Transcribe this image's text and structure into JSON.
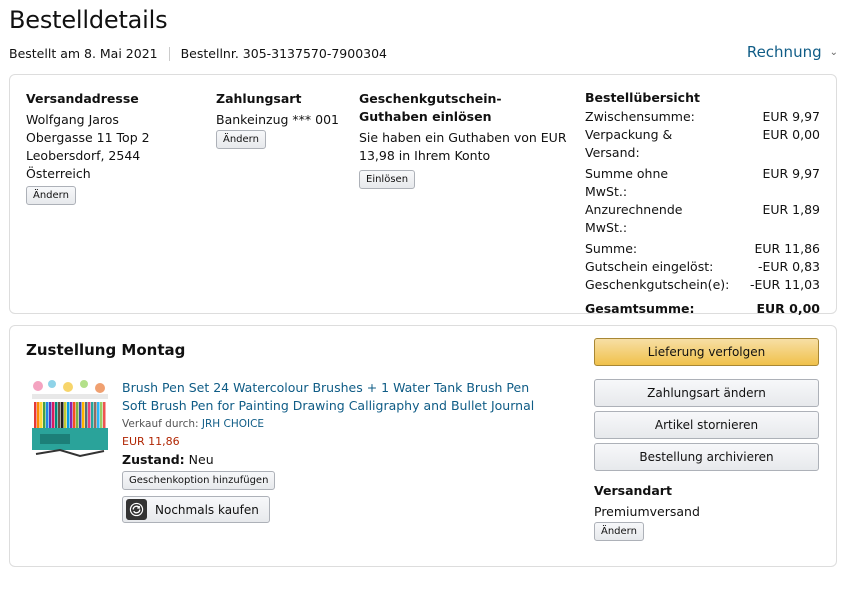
{
  "header": {
    "title": "Bestelldetails",
    "ordered_on": "Bestellt am 8. Mai 2021",
    "order_number": "Bestellnr. 305-3137570-7900304",
    "invoice_label": "Rechnung"
  },
  "shipping_address": {
    "heading": "Versandadresse",
    "name": "Wolfgang Jaros",
    "street": "Obergasse 11 Top 2",
    "city": "Leobersdorf, 2544",
    "country": "Österreich",
    "change_label": "Ändern"
  },
  "payment": {
    "heading": "Zahlungsart",
    "method": "Bankeinzug *** 001",
    "change_label": "Ändern"
  },
  "gift_card": {
    "heading": "Geschenkgutschein-Guthaben einlösen",
    "text": "Sie haben ein Guthaben von EUR 13,98 in Ihrem Konto",
    "redeem_label": "Einlösen"
  },
  "summary": {
    "heading": "Bestellübersicht",
    "subtotal_label": "Zwischensumme:",
    "subtotal_value": "EUR 9,97",
    "shipping_label": "Verpackung & Versand:",
    "shipping_value": "EUR 0,00",
    "net_label": "Summe ohne MwSt.:",
    "net_value": "EUR 9,97",
    "vat_label": "Anzurechnende MwSt.:",
    "vat_value": "EUR 1,89",
    "sum_label": "Summe:",
    "sum_value": "EUR 11,86",
    "voucher_label": "Gutschein eingelöst:",
    "voucher_value": "-EUR 0,83",
    "giftcard_label": "Geschenkgutschein(e):",
    "giftcard_value": "-EUR 11,03",
    "total_label": "Gesamtsumme:",
    "total_value": "EUR 0,00"
  },
  "delivery": {
    "title": "Zustellung Montag",
    "product_title": "Brush Pen Set 24 Watercolour Brushes + 1 Water Tank Brush Pen Soft Brush Pen for Painting Drawing Calligraphy and Bullet Journal",
    "sold_by_label": "Verkauf durch:",
    "seller": "JRH CHOICE",
    "price": "EUR 11,86",
    "condition_label": "Zustand:",
    "condition_value": "Neu",
    "gift_option_label": "Geschenkoption hinzufügen",
    "buy_again_label": "Nochmals kaufen"
  },
  "actions": {
    "track": "Lieferung verfolgen",
    "change_payment": "Zahlungsart ändern",
    "cancel_items": "Artikel stornieren",
    "archive": "Bestellung archivieren"
  },
  "shipping_method": {
    "heading": "Versandart",
    "value": "Premiumversand",
    "change_label": "Ändern"
  },
  "colors": {
    "link": "#0f5c86",
    "price": "#b12704",
    "primary_button": "#f0c14b"
  }
}
